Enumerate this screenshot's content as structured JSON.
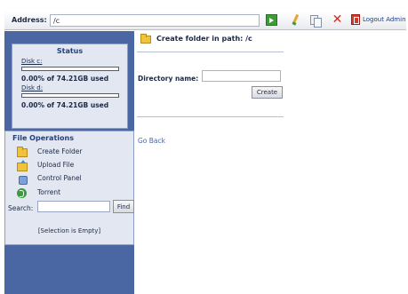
{
  "address_bar": {
    "label": "Address:",
    "value": "/c",
    "icons": [
      "go-icon",
      "pen-icon",
      "copy-icon",
      "delete-icon",
      "logout-icon"
    ],
    "logout_label": "Logout Admin"
  },
  "sidebar": {
    "status": {
      "title": "Status",
      "disks": [
        {
          "label": "Disk c:",
          "usage_text": "0.00% of 74.21GB  used",
          "used_fraction": 0.0
        },
        {
          "label": "Disk d:",
          "usage_text": "0.00% of 74.21GB  used",
          "used_fraction": 0.0
        }
      ]
    },
    "file_operations": {
      "title": "File Operations",
      "items": [
        {
          "label": "Create Folder",
          "icon": "folder-icon"
        },
        {
          "label": "Upload File",
          "icon": "upload-icon"
        },
        {
          "label": "Control Panel",
          "icon": "control-panel-icon"
        },
        {
          "label": "Torrent",
          "icon": "torrent-icon"
        }
      ],
      "search_label": "Search:",
      "search_value": "",
      "find_label": "Find",
      "selection_text": "[Selection is Empty]"
    }
  },
  "main": {
    "title": "Create folder in path: /c",
    "directory_label": "Directory name:",
    "directory_value": "",
    "create_label": "Create",
    "go_back_label": "Go Back"
  },
  "colors": {
    "sidebar_bg": "#4a67a4",
    "panel_bg": "#e2e7f1",
    "heading": "#23407d",
    "link": "#4a67a4"
  }
}
